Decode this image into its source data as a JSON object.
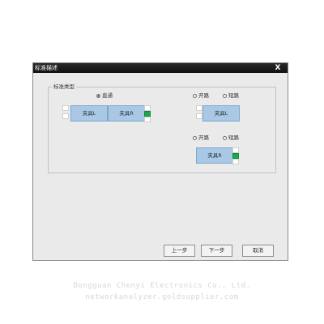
{
  "dialog": {
    "title": "标准描述",
    "close_label": "X"
  },
  "group": {
    "label": "标准类型",
    "thru_radio": {
      "label": "直通",
      "selected": true
    },
    "fixture_l": {
      "open_label": "开路",
      "short_label": "短路",
      "name": "夹具L"
    },
    "fixture_r": {
      "open_label": "开路",
      "short_label": "短路",
      "name": "夹具R"
    },
    "thru_fixture_l": "夹具L",
    "thru_fixture_r": "夹具R"
  },
  "buttons": {
    "prev": "上一步",
    "next": "下一步",
    "cancel": "取消"
  },
  "watermark": {
    "line1": "Dongguan Chenyi Electronics Co., Ltd.",
    "line2": "networkanalyzer.goldsupplier.com"
  },
  "colors": {
    "fixture_fill": "#a8c8e6",
    "port_active": "#1aa84a"
  }
}
